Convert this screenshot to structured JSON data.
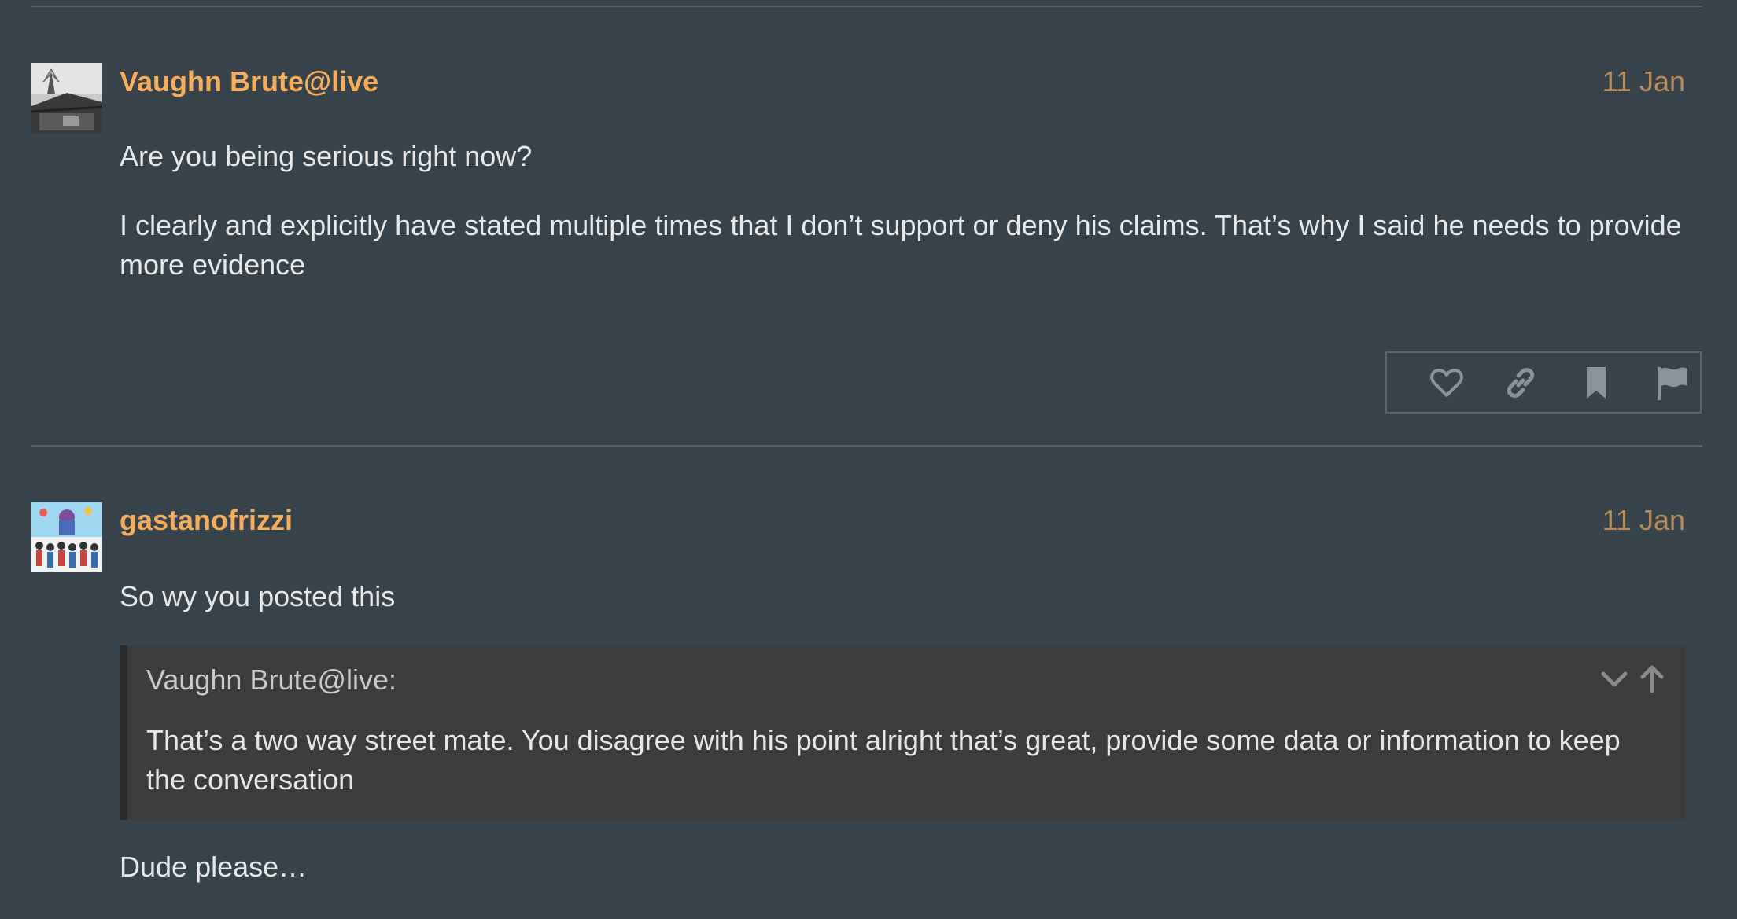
{
  "posts": [
    {
      "username": "Vaughn Brute@live",
      "date": "11 Jan",
      "paragraphs": [
        "Are you being serious right now?",
        "I clearly and explicitly have stated multiple times that I don’t support or deny his claims. That’s why I said he needs to provide more evidence"
      ],
      "actions": [
        "like-icon",
        "link-icon",
        "bookmark-icon",
        "flag-icon"
      ]
    },
    {
      "username": "gastanofrizzi",
      "date": "11 Jan",
      "intro": "So wy you posted this",
      "quote": {
        "author": "Vaughn Brute@live:",
        "text": "That’s a two way street mate. You disagree with his point alright that’s great, provide some data or information to keep the conversation",
        "controls": [
          "chevron-down-icon",
          "arrow-up-icon"
        ]
      },
      "outro": "Dude please…"
    }
  ],
  "colors": {
    "background": "#37424a",
    "username": "#f6ae5c",
    "date": "#b88d5e",
    "quote_bg": "#3c3c3c"
  }
}
